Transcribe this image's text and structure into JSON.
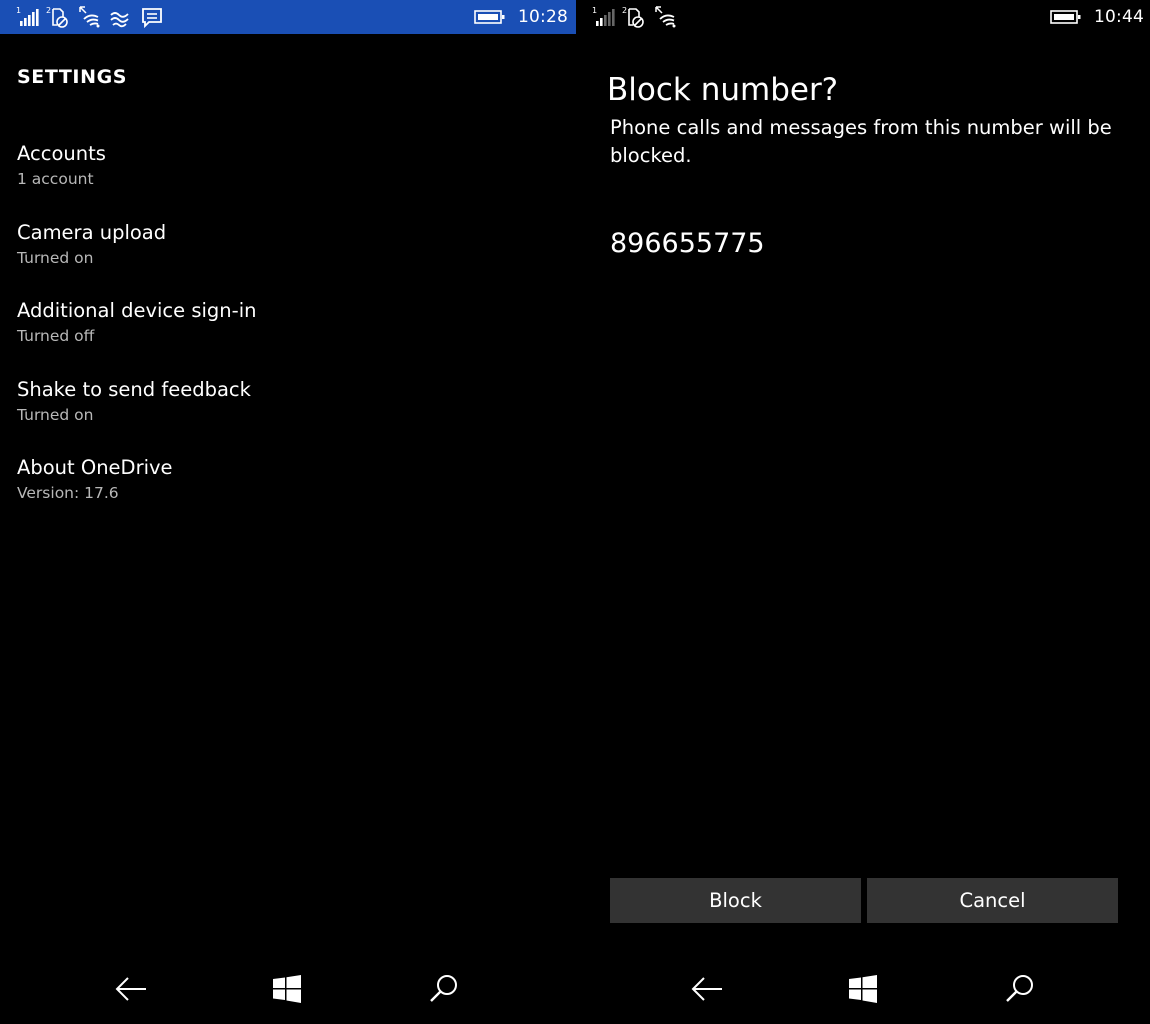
{
  "left": {
    "status": {
      "time": "10:28",
      "sim1": "1",
      "sim2": "2"
    },
    "title": "SETTINGS",
    "items": [
      {
        "label": "Accounts",
        "sub": "1 account"
      },
      {
        "label": "Camera upload",
        "sub": "Turned on"
      },
      {
        "label": "Additional device sign-in",
        "sub": "Turned off"
      },
      {
        "label": "Shake to send feedback",
        "sub": "Turned on"
      },
      {
        "label": "About OneDrive",
        "sub": "Version: 17.6"
      }
    ],
    "nav": {
      "back": "back-arrow-icon",
      "home": "windows-logo-icon",
      "search": "search-icon"
    }
  },
  "right": {
    "status": {
      "time": "10:44",
      "sim1": "1",
      "sim2": "2"
    },
    "dialog": {
      "title": "Block number?",
      "message": "Phone calls and messages from this number will be blocked.",
      "number": "896655775",
      "block_label": "Block",
      "cancel_label": "Cancel"
    },
    "nav": {
      "back": "back-arrow-icon",
      "home": "windows-logo-icon",
      "search": "search-icon"
    }
  },
  "colors": {
    "status_bar_left": "#1a4fb5",
    "background": "#000000",
    "button": "#333333",
    "subtext": "#b8b8b8"
  }
}
